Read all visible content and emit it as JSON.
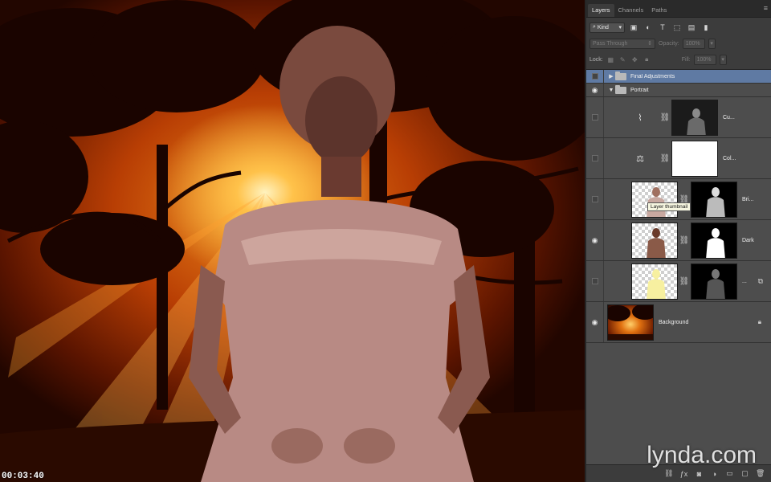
{
  "canvas": {
    "timecode": "00:03:40"
  },
  "panel": {
    "tabs": [
      {
        "label": "Layers",
        "active": true
      },
      {
        "label": "Channels",
        "active": false
      },
      {
        "label": "Paths",
        "active": false
      }
    ],
    "filter": {
      "kind_label": "Kind"
    },
    "blend_mode": "Pass Through",
    "opacity_label": "Opacity:",
    "opacity_value": "100%",
    "lock_label": "Lock:",
    "fill_label": "Fill:",
    "fill_value": "100%",
    "layers": [
      {
        "name": "Final Adjustments",
        "type": "group",
        "visible": false,
        "expanded": false,
        "selected": true
      },
      {
        "name": "Portrait",
        "type": "group",
        "visible": true,
        "expanded": true,
        "selected": false
      },
      {
        "name": "Cu...",
        "type": "adjustment",
        "adjustment_icon": "curves-icon",
        "visible": false
      },
      {
        "name": "Col...",
        "type": "adjustment",
        "adjustment_icon": "balance-icon",
        "visible": false
      },
      {
        "name": "Bri...",
        "type": "pixel",
        "visible": false,
        "tooltip": "Layer thumbnail"
      },
      {
        "name": "Dark",
        "type": "pixel",
        "visible": true
      },
      {
        "name": "...",
        "type": "pixel-smart",
        "visible": false
      },
      {
        "name": "Background",
        "type": "background",
        "visible": true,
        "locked": true
      }
    ]
  },
  "watermark": {
    "brand": "lynda",
    "suffix": ".com"
  },
  "colors": {
    "panel_bg": "#3c3c3c",
    "selected_row": "#5f7aa3",
    "sky_glow": "#f08a1a"
  }
}
